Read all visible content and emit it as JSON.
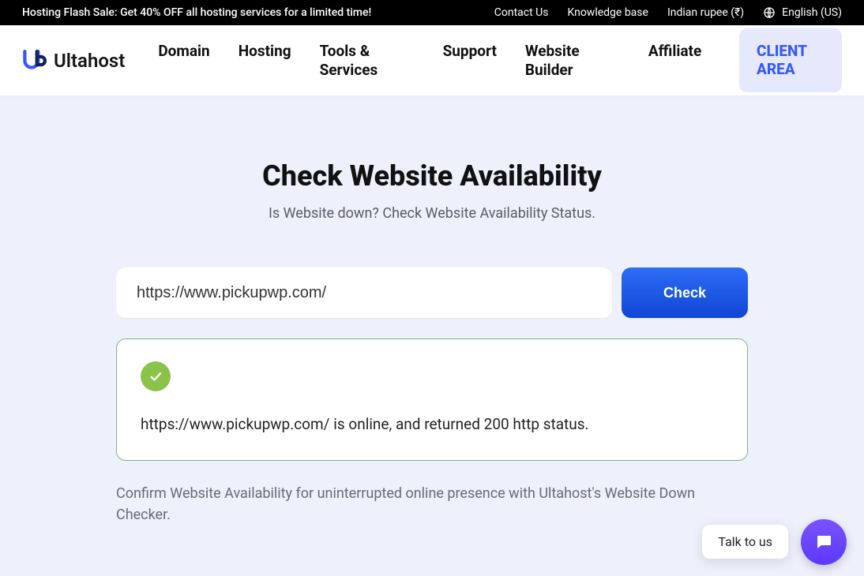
{
  "promo": {
    "text": "Hosting Flash Sale: Get 40% OFF all hosting services for a limited time!",
    "contact": "Contact Us",
    "kb": "Knowledge base",
    "currency": "Indian rupee (₹)",
    "language": "English (US)"
  },
  "brand": {
    "name": "Ultahost"
  },
  "nav": {
    "domain": "Domain",
    "hosting": "Hosting",
    "tools": "Tools & Services",
    "support": "Support",
    "builder": "Website Builder",
    "affiliate": "Affiliate",
    "client_area": "CLIENT AREA"
  },
  "hero": {
    "title": "Check Website Availability",
    "subtitle": "Is Website down? Check Website Availability Status."
  },
  "checker": {
    "url_value": "https://www.pickupwp.com/",
    "check_label": "Check",
    "result_text": "https://www.pickupwp.com/ is online, and returned 200 http status.",
    "confirm_text": "Confirm Website Availability for uninterrupted online presence with Ultahost's Website Down Checker."
  },
  "chat": {
    "talk_label": "Talk to us"
  }
}
